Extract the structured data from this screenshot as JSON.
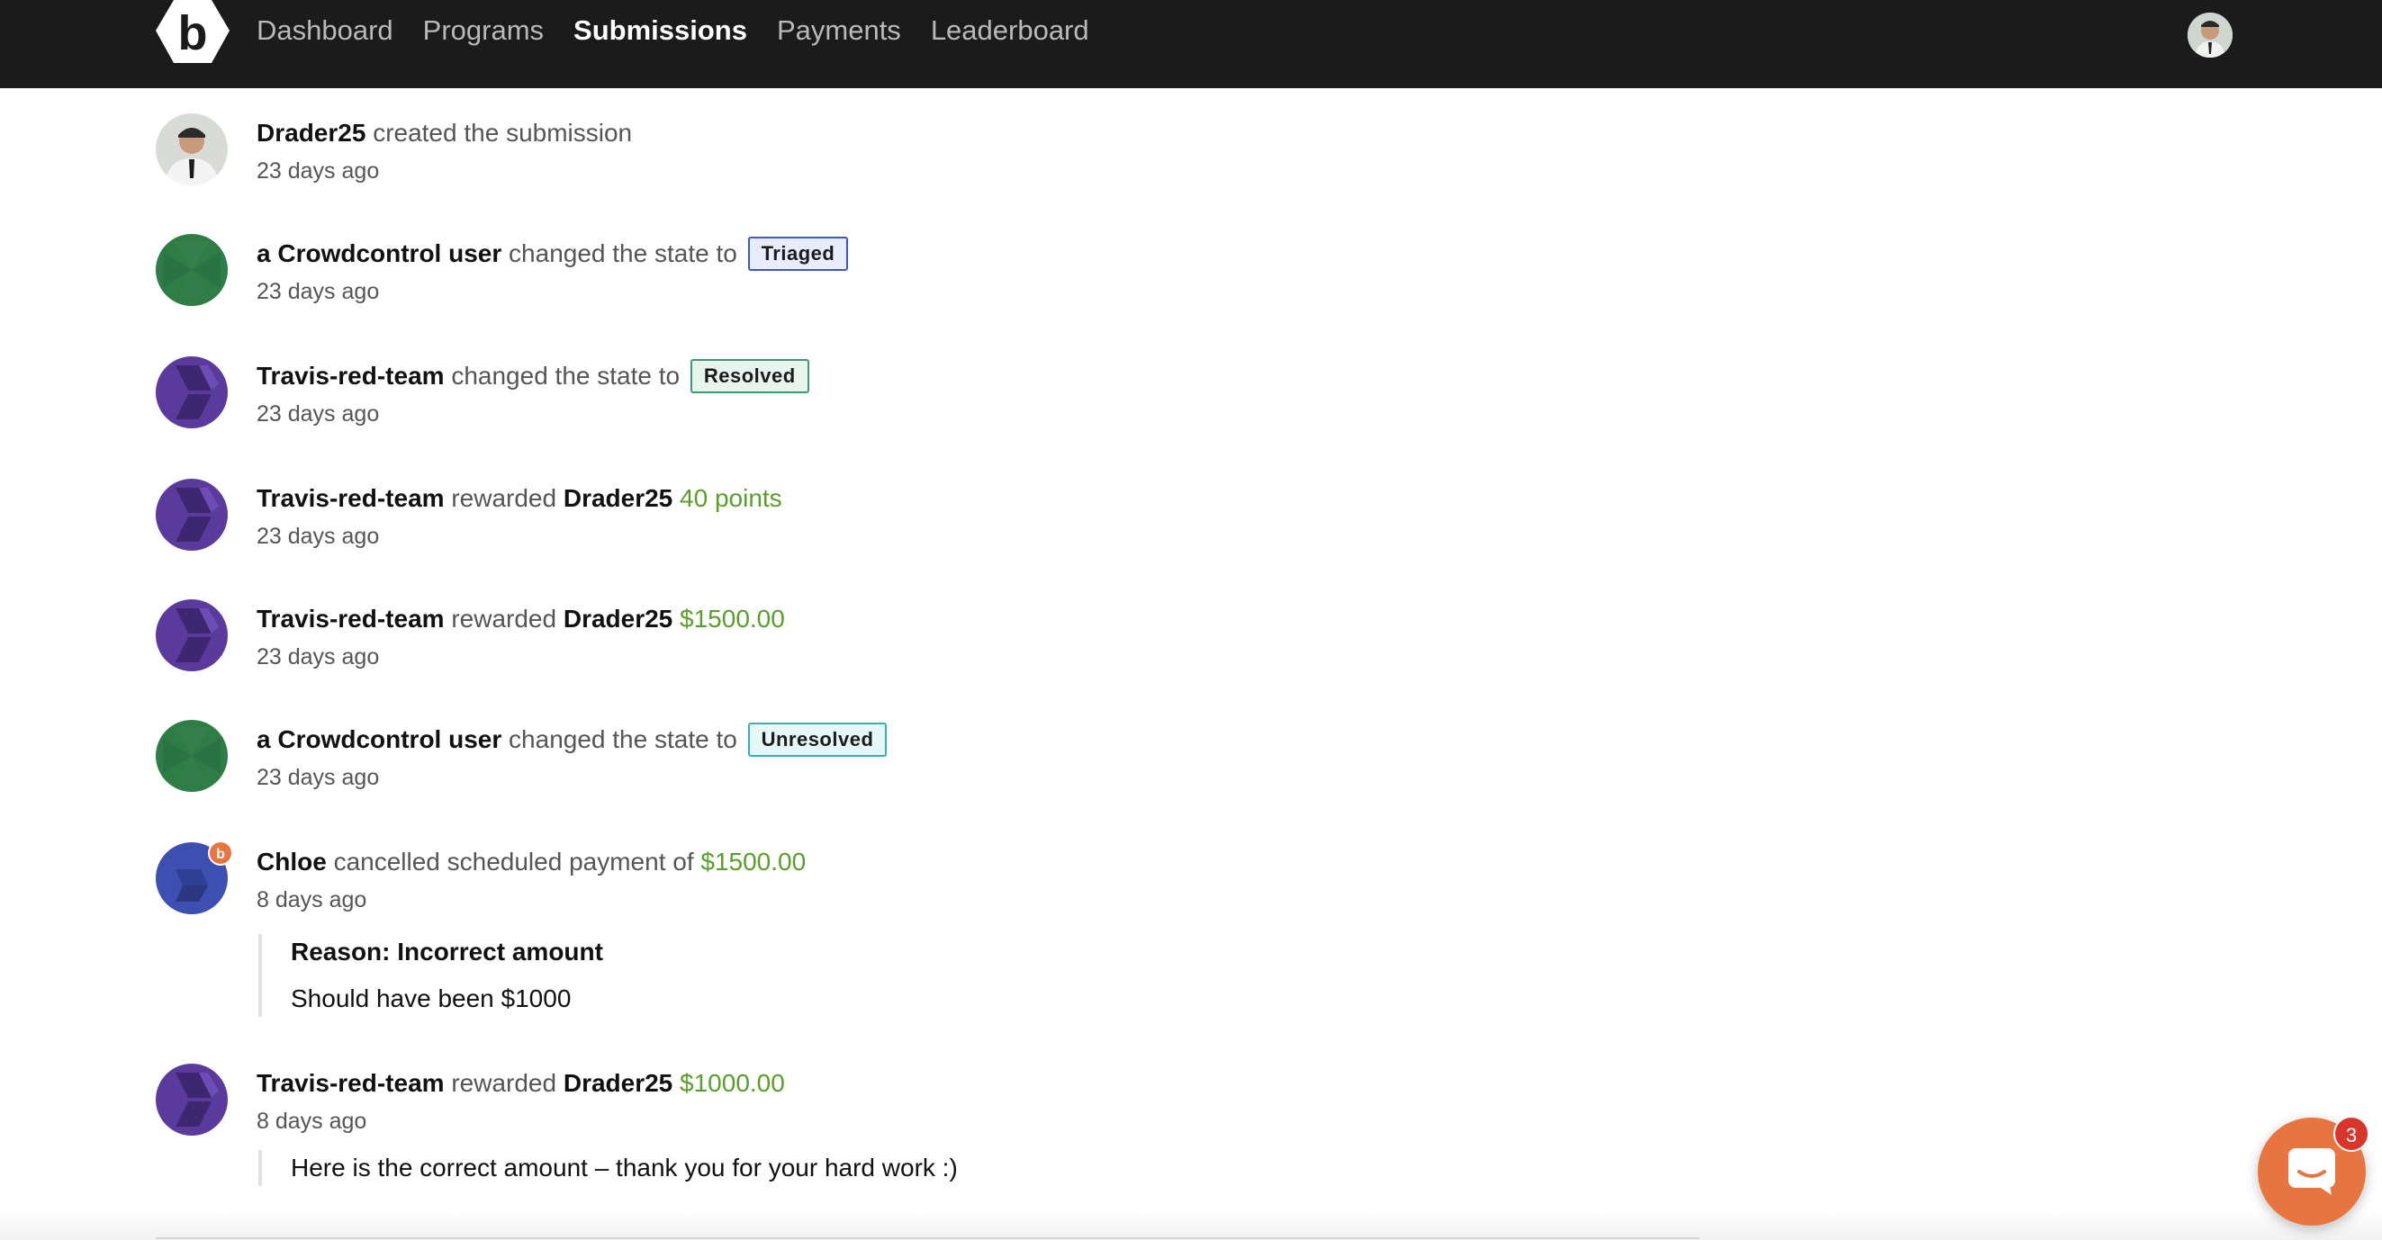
{
  "nav": {
    "logo_letter": "b",
    "links": [
      "Dashboard",
      "Programs",
      "Submissions",
      "Payments",
      "Leaderboard"
    ],
    "active_link": "Submissions"
  },
  "timeline": {
    "events": [
      {
        "actor": "Drader25",
        "action": "created the submission",
        "time": "23 days ago",
        "avatar": "user-photo"
      },
      {
        "actor": "a Crowdcontrol user",
        "action": "changed the state to",
        "badge": "Triaged",
        "time": "23 days ago",
        "avatar": "green-hex"
      },
      {
        "actor": "Travis-red-team",
        "action": "changed the state to",
        "badge": "Resolved",
        "time": "23 days ago",
        "avatar": "purple-hex"
      },
      {
        "actor": "Travis-red-team",
        "action": "rewarded",
        "target": "Drader25",
        "amount": "40 points",
        "time": "23 days ago",
        "avatar": "purple-hex"
      },
      {
        "actor": "Travis-red-team",
        "action": "rewarded",
        "target": "Drader25",
        "amount": "$1500.00",
        "time": "23 days ago",
        "avatar": "purple-hex"
      },
      {
        "actor": "a Crowdcontrol user",
        "action": "changed the state to",
        "badge": "Unresolved",
        "time": "23 days ago",
        "avatar": "green-hex"
      },
      {
        "actor": "Chloe",
        "action": "cancelled scheduled payment of",
        "amount": "$1500.00",
        "time": "8 days ago",
        "avatar": "blue-staff",
        "staff_badge": "b",
        "quote_title": "Reason: Incorrect amount",
        "quote_body": "Should have been $1000"
      },
      {
        "actor": "Travis-red-team",
        "action": "rewarded",
        "target": "Drader25",
        "amount": "$1000.00",
        "time": "8 days ago",
        "avatar": "purple-hex",
        "quote_body": "Here is the correct amount – thank you for your hard work :)"
      }
    ]
  },
  "chat": {
    "unread_count": "3"
  },
  "colors": {
    "nav_bg": "#1b1b1b",
    "amount_green": "#5a9f2c",
    "triaged_border": "#3f56c9",
    "resolved_border": "#3f9b73",
    "unresolved_border": "#35b2b1",
    "chat_orange": "#e8753f",
    "avatar_green": "#2e7d46",
    "avatar_purple": "#5b3a9e",
    "avatar_blue": "#3d4fb0"
  }
}
